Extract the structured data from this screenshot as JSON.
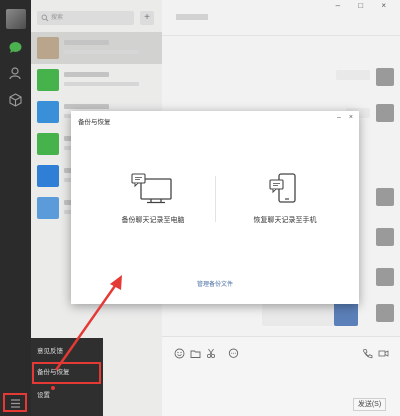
{
  "sidebar": {
    "icons": [
      "avatar",
      "chat-icon",
      "contacts-icon",
      "cube-icon",
      "menu-icon"
    ]
  },
  "contacts": {
    "search_placeholder": "搜索",
    "add_label": "+",
    "avatar_colors": [
      "#b8a58b",
      "#46b24b",
      "#3a8fd9",
      "#46b24b",
      "#2f7fd6",
      "#5b9bd9"
    ]
  },
  "chat": {
    "window_controls": "‒ □ ×",
    "send_label": "发送(S)"
  },
  "popup_menu": {
    "items": [
      "意见反馈",
      "备份与恢复",
      "设置"
    ]
  },
  "dialog": {
    "title": "备份与恢复",
    "controls": [
      "‒",
      "×"
    ],
    "options": [
      {
        "label": "备份聊天记录至电脑",
        "icon": "monitor-icon"
      },
      {
        "label": "恢复聊天记录至手机",
        "icon": "phone-icon"
      }
    ],
    "manage_link": "管理备份文件"
  },
  "colors": {
    "highlight": "#e53935",
    "sidebar_bg": "#2b2b2b",
    "link": "#4a6fa5"
  }
}
